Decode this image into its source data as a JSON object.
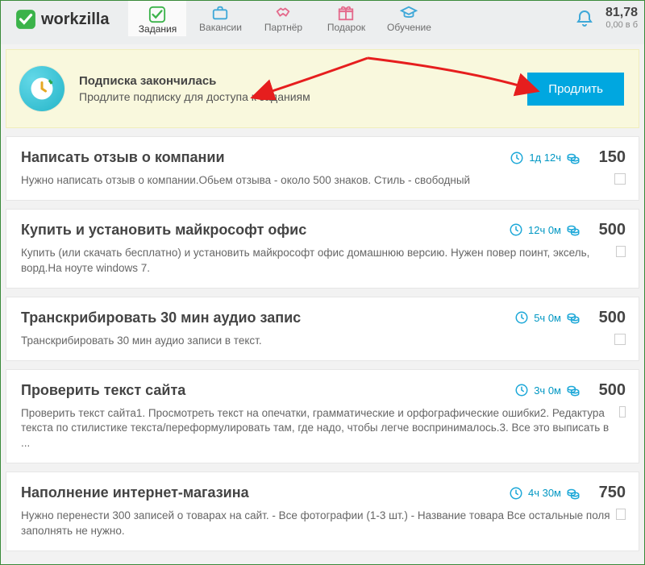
{
  "brand": "workzilla",
  "nav": [
    {
      "label": "Задания",
      "icon": "check",
      "active": true
    },
    {
      "label": "Вакансии",
      "icon": "briefcase",
      "active": false
    },
    {
      "label": "Партнёр",
      "icon": "handshake",
      "active": false
    },
    {
      "label": "Подарок",
      "icon": "gift",
      "active": false
    },
    {
      "label": "Обучение",
      "icon": "cap",
      "active": false
    }
  ],
  "balance": {
    "main": "81,78",
    "sub": "0,00 в б"
  },
  "banner": {
    "title": "Подписка закончилась",
    "subtitle": "Продлите подписку для доступа к заданиям",
    "button": "Продлить"
  },
  "tasks": [
    {
      "title": "Написать отзыв о компании",
      "time": "1д 12ч",
      "price": "150",
      "desc": "Нужно написать отзыв о компании.Обьем отзыва - около 500 знаков. Стиль - свободный"
    },
    {
      "title": "Купить и установить майкрософт офис",
      "time": "12ч 0м",
      "price": "500",
      "desc": "Купить (или скачать бесплатно) и установить майкрософт офис домашнюю версию. Нужен повер поинт, эксель, ворд.На ноуте windows 7."
    },
    {
      "title": "Транскрибировать 30 мин аудио запис",
      "time": "5ч 0м",
      "price": "500",
      "desc": "Транскрибировать 30 мин аудио записи в текст."
    },
    {
      "title": "Проверить текст сайта",
      "time": "3ч 0м",
      "price": "500",
      "desc": "Проверить текст сайта1. Просмотреть текст на опечатки, грамматические и орфографические ошибки2. Редактура текста по стилистике текста/переформулировать там, где надо, чтобы легче воспринималось.3. Все это выписать в ..."
    },
    {
      "title": "Наполнение интернет-магазина",
      "time": "4ч 30м",
      "price": "750",
      "desc": "Нужно перенести 300 записей о товарах на сайт. - Все фотографии (1-3 шт.) - Название товара Все остальные поля заполнять не нужно."
    }
  ]
}
